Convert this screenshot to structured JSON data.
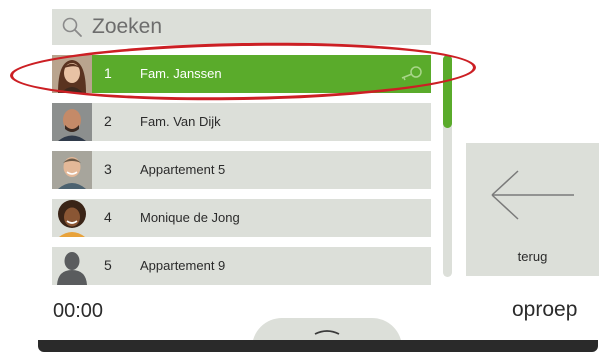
{
  "search": {
    "label": "Zoeken",
    "icon": "search-icon"
  },
  "contacts": [
    {
      "number": "1",
      "name": "Fam. Janssen",
      "selected": true,
      "avatar": "woman-brown-hair",
      "badge": "key-icon"
    },
    {
      "number": "2",
      "name": "Fam. Van Dijk",
      "selected": false,
      "avatar": "man-bald"
    },
    {
      "number": "3",
      "name": "Appartement 5",
      "selected": false,
      "avatar": "man-smiling"
    },
    {
      "number": "4",
      "name": "Monique de Jong",
      "selected": false,
      "avatar": "woman-curly-hair"
    },
    {
      "number": "5",
      "name": "Appartement 9",
      "selected": false,
      "avatar": "person-silhouette"
    }
  ],
  "scrollbar": {
    "thumb_fraction": 0.33
  },
  "back_button": {
    "label": "terug",
    "icon": "arrow-left-icon"
  },
  "footer": {
    "time": "00:00",
    "call_label": "oproep",
    "expand_icon": "chevron-up-icon"
  },
  "colors": {
    "accent": "#5aab2b",
    "tile": "#dcdfd9",
    "highlight": "#cc1f24",
    "text": "#2b2b2b"
  }
}
